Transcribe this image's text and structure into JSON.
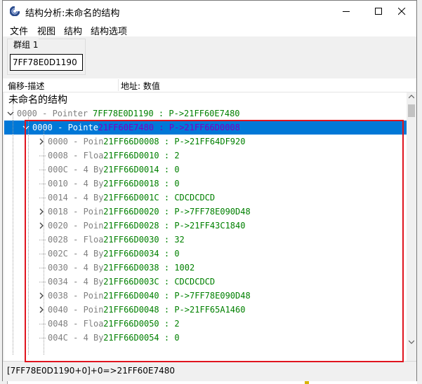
{
  "window": {
    "title": "结构分析:未命名的结构",
    "controls": {
      "minimize": "minimize-icon",
      "maximize": "maximize-icon",
      "close": "close-icon"
    }
  },
  "menu": [
    "文件",
    "视图",
    "结构",
    "结构选项"
  ],
  "group": {
    "label": "群组 1",
    "address": "7FF78E0D1190"
  },
  "columns": {
    "offset": "偏移-描述",
    "address": "地址: 数值"
  },
  "tree": {
    "root": "未命名的结构",
    "rows": [
      {
        "desc": "0000 - Pointer ",
        "val": "7FF78E0D1190 : P->21FF60E7480"
      },
      {
        "desc": "0000 - Pointe",
        "val": "21FF60E7480 : P->21FF66D0008"
      },
      {
        "desc": "0000 - Poin",
        "val": "21FF66D0008 : P->21FF64DF920"
      },
      {
        "desc": "0008 - Floa",
        "val": "21FF66D0010 : 2"
      },
      {
        "desc": "000C - 4 By",
        "val": "21FF66D0014 : 0"
      },
      {
        "desc": "0010 - 4 By",
        "val": "21FF66D0018 : 0"
      },
      {
        "desc": "0014 - 4 By",
        "val": "21FF66D001C : CDCDCDCD"
      },
      {
        "desc": "0018 - Poin",
        "val": "21FF66D0020 : P->7FF78E090D48"
      },
      {
        "desc": "0020 - Poin",
        "val": "21FF66D0028 : P->21FF43C1840"
      },
      {
        "desc": "0028 - Floa",
        "val": "21FF66D0030 : 32"
      },
      {
        "desc": "002C - 4 By",
        "val": "21FF66D0034 : 0"
      },
      {
        "desc": "0030 - 4 By",
        "val": "21FF66D0038 : 1002"
      },
      {
        "desc": "0034 - 4 By",
        "val": "21FF66D003C : CDCDCDCD"
      },
      {
        "desc": "0038 - Poin",
        "val": "21FF66D0040 : P->7FF78E090D48"
      },
      {
        "desc": "0040 - Poin",
        "val": "21FF66D0048 : P->21FF65A1460"
      },
      {
        "desc": "0048 - Floa",
        "val": "21FF66D0050 : 2"
      },
      {
        "desc": "004C - 4 By",
        "val": "21FF66D0054 : 0"
      }
    ]
  },
  "status": "[7FF78E0D1190+0]+0=>21FF60E7480",
  "colors": {
    "selection": "#0078d7",
    "value_text": "#008000",
    "selected_value_text": "#8000c0",
    "highlight_box": "#e0141e"
  }
}
